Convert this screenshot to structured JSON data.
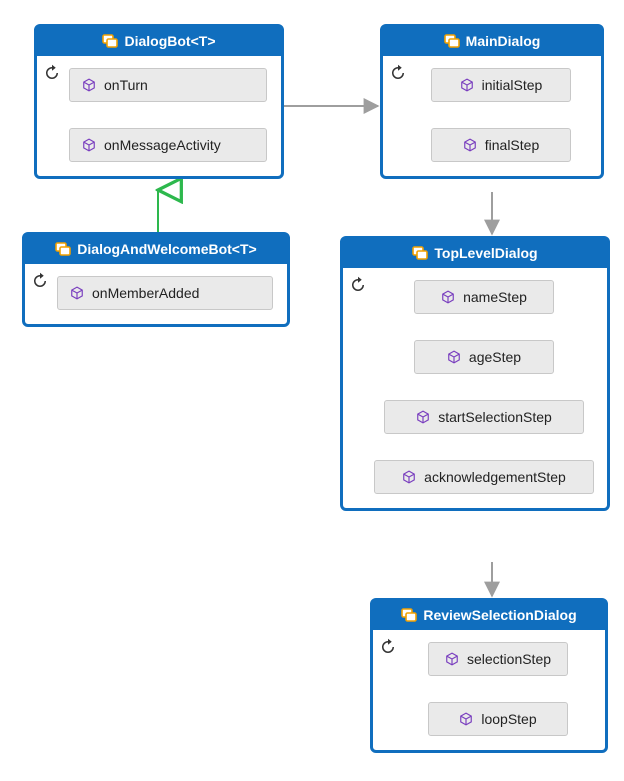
{
  "colors": {
    "primary": "#106ebe",
    "step_bg": "#eaeaea",
    "step_border": "#c8c8c8",
    "arrow": "#9e9e9e",
    "inherit": "#2db84d"
  },
  "boxes": {
    "dialogBot": {
      "title": "DialogBot<T>",
      "steps": [
        "onTurn",
        "onMessageActivity"
      ]
    },
    "dialogAndWelcomeBot": {
      "title": "DialogAndWelcomeBot<T>",
      "steps": [
        "onMemberAdded"
      ]
    },
    "mainDialog": {
      "title": "MainDialog",
      "steps": [
        "initialStep",
        "finalStep"
      ]
    },
    "topLevelDialog": {
      "title": "TopLevelDialog",
      "steps": [
        "nameStep",
        "ageStep",
        "startSelectionStep",
        "acknowledgementStep"
      ]
    },
    "reviewSelectionDialog": {
      "title": "ReviewSelectionDialog",
      "steps": [
        "selectionStep",
        "loopStep"
      ]
    }
  },
  "icons": {
    "class": "class-icon",
    "cube": "cube-icon",
    "loop": "loop-icon"
  }
}
